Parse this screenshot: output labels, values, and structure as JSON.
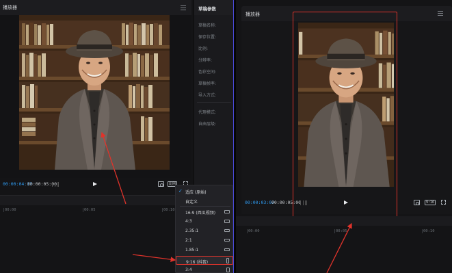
{
  "left_window": {
    "player_title": "播放器",
    "timecode_current": "00:00:04:17",
    "timecode_total": "00:00:05:00",
    "ratio_button_label": "比例",
    "draft_params": {
      "title": "草稿参数",
      "rows": [
        "草稿名称:",
        "保存位置:",
        "比例:",
        "分辨率:",
        "色彩空间:",
        "草稿帧率:",
        "导入方式:",
        "代理模式:",
        "自由层级:"
      ]
    },
    "timeline_ticks": [
      "00:00",
      "00:05",
      "00:10"
    ],
    "ratio_menu": {
      "items": [
        {
          "label": "适应 (原始)",
          "checked": true,
          "shape": "none"
        },
        {
          "label": "自定义",
          "checked": false,
          "shape": "none"
        },
        {
          "label": "16:9 (西瓜视频)",
          "checked": false,
          "shape": "wide"
        },
        {
          "label": "4:3",
          "checked": false,
          "shape": "wide"
        },
        {
          "label": "2.35:1",
          "checked": false,
          "shape": "wide"
        },
        {
          "label": "2:1",
          "checked": false,
          "shape": "wide"
        },
        {
          "label": "1.85:1",
          "checked": false,
          "shape": "wide"
        },
        {
          "label": "9:16 (抖音)",
          "checked": false,
          "shape": "tall",
          "highlighted": true
        },
        {
          "label": "3:4",
          "checked": false,
          "shape": "tall"
        }
      ]
    }
  },
  "right_window": {
    "player_title": "播放器",
    "timecode_current": "00:00:03:07",
    "timecode_total": "00:00:05:00",
    "ratio_button_label": "9:16",
    "timeline_ticks": [
      "00:00",
      "00:05",
      "00:10"
    ]
  },
  "colors": {
    "accent_blue": "#2f9df4",
    "annotation_red": "#e0332b"
  }
}
